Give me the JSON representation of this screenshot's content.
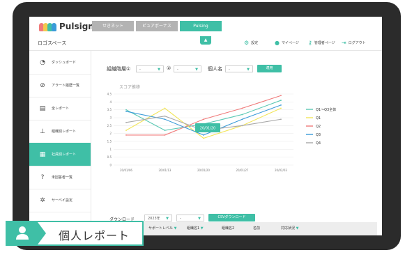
{
  "app": {
    "brand": "Pulsign",
    "space": "ロゴスペース"
  },
  "top_tabs": [
    {
      "label": "せきネット",
      "active": false
    },
    {
      "label": "ピュアボーナス",
      "active": false
    },
    {
      "label": "Pulsing",
      "active": true
    }
  ],
  "subnav": [
    {
      "icon": "gear-icon",
      "label": "設定"
    },
    {
      "icon": "user-icon",
      "label": "マイページ"
    },
    {
      "icon": "key-icon",
      "label": "管理者ページ"
    },
    {
      "icon": "logout-icon",
      "label": "ログアウト"
    }
  ],
  "sidebar": {
    "items": [
      {
        "icon": "dashboard-icon",
        "label": "ダッシュボード",
        "active": false
      },
      {
        "icon": "alert-icon",
        "label": "アラート履歴一覧",
        "active": false
      },
      {
        "icon": "document-icon",
        "label": "全レポート",
        "active": false
      },
      {
        "icon": "org-icon",
        "label": "組織別レポート",
        "active": false
      },
      {
        "icon": "person-report-icon",
        "label": "社員別レポート",
        "active": true
      },
      {
        "icon": "question-icon",
        "label": "未回答者一覧",
        "active": false
      },
      {
        "icon": "settings-icon",
        "label": "サーベイ設定",
        "active": false
      }
    ]
  },
  "filters": {
    "org_label": "組織階層①",
    "org2_label": "②",
    "person_label": "個人名",
    "select_placeholder": "-",
    "apply": "適用"
  },
  "chart_data": {
    "type": "line",
    "title": "スコア推移",
    "x": [
      "20/01/06",
      "20/01/13",
      "20/01/20",
      "20/01/27",
      "20/02/03"
    ],
    "ylim": [
      0,
      4.5
    ],
    "yticks": [
      "0",
      "0.5",
      "1",
      "1.5",
      "2",
      "2.5",
      "3",
      "3.5",
      "4",
      "4.5"
    ],
    "tooltip": "20/01/20",
    "series": [
      {
        "name": "Q1〜Q3全体",
        "color": "#5cc9b5",
        "values": [
          3.5,
          2.2,
          2.6,
          3.2,
          4.1
        ]
      },
      {
        "name": "Q1",
        "color": "#f2e55a",
        "values": [
          2.2,
          3.6,
          1.7,
          2.5,
          3.6
        ]
      },
      {
        "name": "Q2",
        "color": "#f07a7a",
        "values": [
          1.9,
          1.9,
          2.9,
          3.6,
          4.4
        ]
      },
      {
        "name": "Q3",
        "color": "#3a9bd9",
        "values": [
          3.4,
          2.9,
          1.9,
          2.9,
          3.8
        ]
      },
      {
        "name": "Q4",
        "color": "#a8a8a8",
        "values": [
          2.7,
          3.1,
          2.2,
          2.5,
          2.9
        ]
      }
    ],
    "legend": "right"
  },
  "download": {
    "label": "ダウンロード",
    "year": "2023年",
    "month": "-",
    "csv": "CSVダウンロード"
  },
  "table": {
    "headers": [
      "サポートレベル",
      "組織名1",
      "組織名2",
      "名前",
      "対応状況"
    ]
  },
  "badge": {
    "label": "個人レポート"
  }
}
